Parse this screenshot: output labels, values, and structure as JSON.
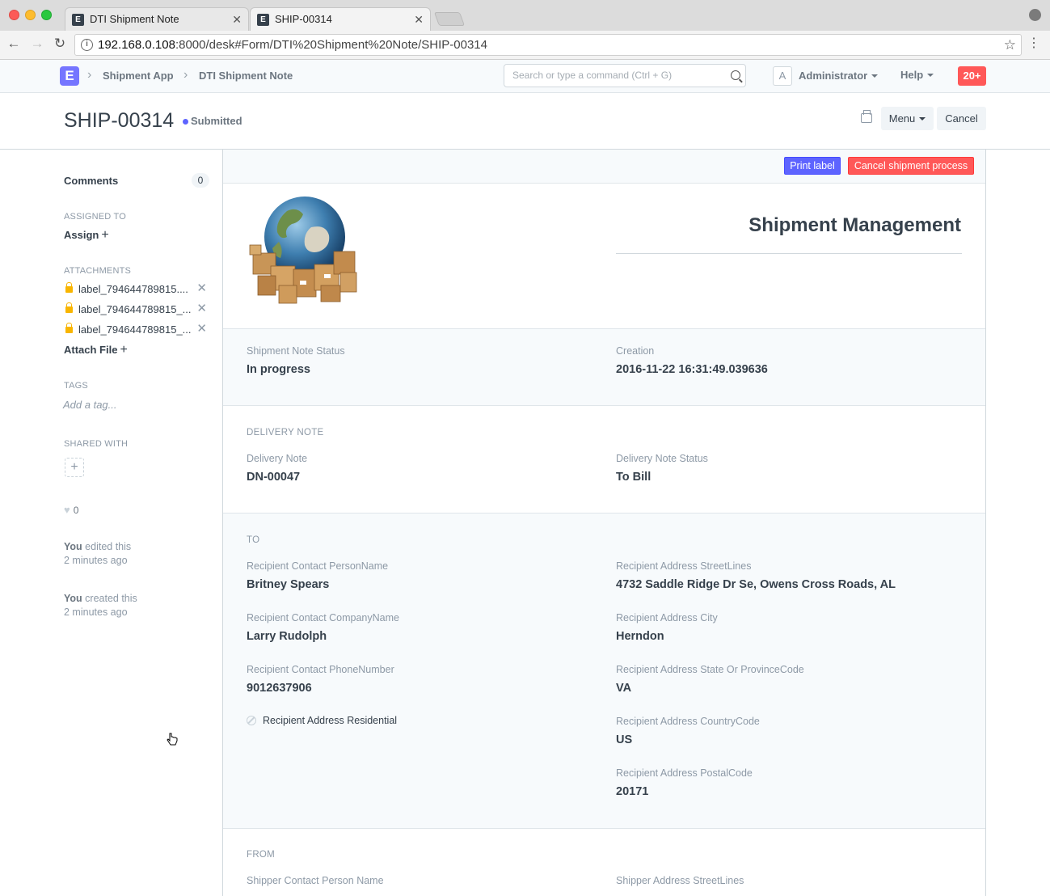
{
  "browser": {
    "tabs": [
      {
        "label": "DTI Shipment Note",
        "favicon": "E"
      },
      {
        "label": "SHIP-00314",
        "favicon": "E"
      }
    ],
    "url_host": "192.168.0.108",
    "url_rest": ":8000/desk#Form/DTI%20Shipment%20Note/SHIP-00314"
  },
  "navbar": {
    "logo_letter": "E",
    "breadcrumbs": [
      "Shipment App",
      "DTI Shipment Note"
    ],
    "search_placeholder": "Search or type a command (Ctrl + G)",
    "avatar_letter": "A",
    "user": "Administrator",
    "help": "Help",
    "notifications": "20+",
    "accent_color": "#7575ff"
  },
  "page": {
    "title": "SHIP-00314",
    "status": "Submitted",
    "status_color": "#5e64ff",
    "menu_label": "Menu",
    "cancel_label": "Cancel"
  },
  "sidebar": {
    "comments_label": "Comments",
    "comments_count": "0",
    "assigned_label": "ASSIGNED TO",
    "assign_action": "Assign",
    "attachments_label": "ATTACHMENTS",
    "attachments": [
      "label_794644789815....",
      "label_794644789815_...",
      "label_794644789815_..."
    ],
    "attach_action": "Attach File",
    "tags_label": "TAGS",
    "tag_placeholder": "Add a tag...",
    "shared_label": "SHARED WITH",
    "likes": "0",
    "timeline": [
      {
        "who": "You",
        "what": " edited this",
        "when": "2 minutes ago"
      },
      {
        "who": "You",
        "what": " created this",
        "when": "2 minutes ago"
      }
    ]
  },
  "form": {
    "actions": {
      "print_label": "Print label",
      "cancel_shipment": "Cancel shipment process"
    },
    "hero_title": "Shipment Management",
    "status_section": {
      "left": {
        "label": "Shipment Note Status",
        "value": "In progress"
      },
      "right": {
        "label": "Creation",
        "value": "2016-11-22 16:31:49.039636"
      }
    },
    "delivery_section": {
      "heading": "DELIVERY NOTE",
      "left": {
        "label": "Delivery Note",
        "value": "DN-00047"
      },
      "right": {
        "label": "Delivery Note Status",
        "value": "To Bill"
      }
    },
    "to_section": {
      "heading": "TO",
      "left": [
        {
          "label": "Recipient Contact PersonName",
          "value": "Britney Spears"
        },
        {
          "label": "Recipient Contact CompanyName",
          "value": "Larry Rudolph"
        },
        {
          "label": "Recipient Contact PhoneNumber",
          "value": "9012637906"
        }
      ],
      "checkbox_label": "Recipient Address Residential",
      "right": [
        {
          "label": "Recipient Address StreetLines",
          "value": "4732 Saddle Ridge Dr Se, Owens Cross Roads, AL"
        },
        {
          "label": "Recipient Address City",
          "value": "Herndon"
        },
        {
          "label": "Recipient Address State Or ProvinceCode",
          "value": "VA"
        },
        {
          "label": "Recipient Address CountryCode",
          "value": "US"
        },
        {
          "label": "Recipient Address PostalCode",
          "value": "20171"
        }
      ]
    },
    "from_section": {
      "heading": "FROM",
      "left_label": "Shipper Contact Person Name",
      "right_label": "Shipper Address StreetLines"
    }
  }
}
